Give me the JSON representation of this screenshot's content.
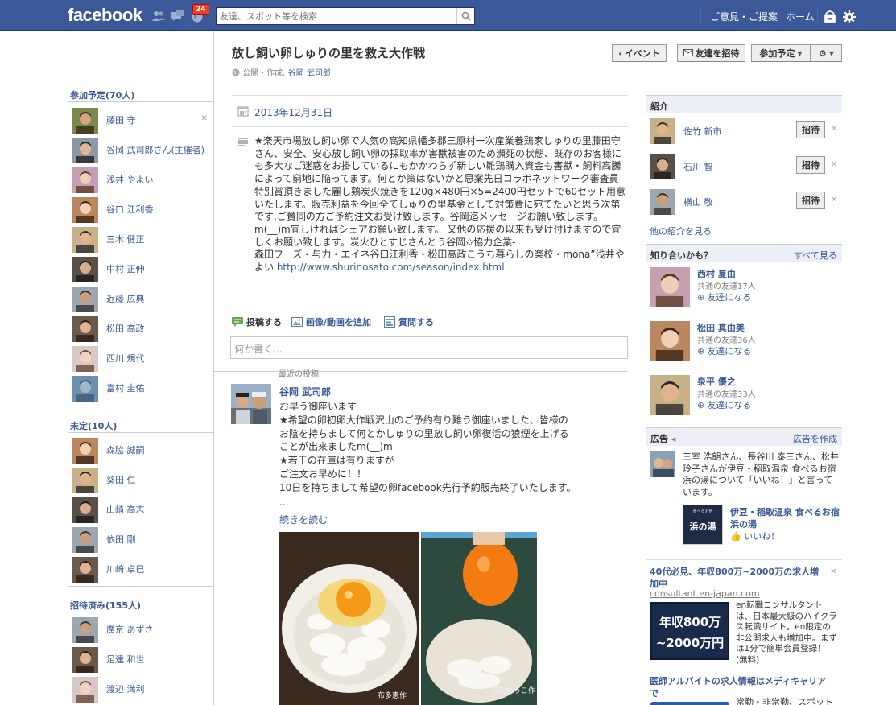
{
  "topbar": {
    "logo": "facebook",
    "notification_count": "24",
    "search_placeholder": "友達、スポット等を検索",
    "feedback": "ご意見・ご提案",
    "home": "ホーム"
  },
  "event": {
    "title": "放し飼い卵しゅりの里を救え大作戦",
    "privacy": "公開・作成:",
    "creator": "谷岡 武司郎",
    "date": "2013年12月31日",
    "description": "★楽天市場放し飼い卵で人気の高知県幡多郡三原村一次産業養鶏家しゅりの里藤田守さん、安全、安心放し飼い卵の採取率が害獣被害のため瀕死の状態、既存のお客様にも多大なご迷惑をお掛しているにもかかわらず新しい雛鶏購入資金も害獣・飼料高騰によって窮地に陥ってます。何とか策はないかと思案先日コラボネットワーク審査員特別賞頂きました麗し鶏炭火焼きを120g×480円×5=2400円セットで60セット用意いたします。販売利益を今回全てしゅりの里基金として対策費に宛てたいと思う次第です,ご賛同の方ご予約注文お受け致します。谷岡迄メッセージお願い致します。m(__)m宜しければシェアお願い致します。 又他の応援の以来も受け付けますので宜しくお願い致します。炭火ひとすじさんとう谷岡✩協力企業-\n森田フーズ・与力・エイネ谷口江利香・松田高政こうち暮らしの楽校・mona”浅井やよい ",
    "link": "http://www.shurinosato.com/season/index.html"
  },
  "toolbar": {
    "event_btn": "イベント",
    "invite_btn": "友達を招待",
    "going_btn": "参加予定"
  },
  "composer": {
    "post": "投稿する",
    "photo": "画像/動画を追加",
    "question": "質問する",
    "placeholder": "何か書く..."
  },
  "recent": {
    "label": "最近の投稿",
    "author": "谷岡 武司郎",
    "lines": [
      "お早う御座います",
      "★希望の卵初卵大作戦沢山のご予約有り難う御座いました、皆様の",
      "お陰を持ちまして何とかしゅりの里放し飼い卵復活の狼煙を上げる",
      "ことが出来ましたm(__)m",
      "★若干の在庫は有りますが",
      "ご注文お早めに！！",
      "10日を持ちまして希望の卵facebook先行予約販売終了いたします。"
    ],
    "ellipsis": "...",
    "read_more": "続きを読む",
    "photo_caption_left": "布多恵作",
    "photo_caption_right": "高知ゆうこ作"
  },
  "left": {
    "going_header": "参加予定(70人)",
    "going": [
      "藤田 守",
      "谷岡 武司郎さん(主催者)",
      "浅井 やよい",
      "谷口 江利香",
      "三木 健正",
      "中村 正伸",
      "近藤 広典",
      "松田 高政",
      "西川 規代",
      "富村 圭佑"
    ],
    "maybe_header": "未定(10人)",
    "maybe": [
      "森脇 誠嗣",
      "葵田 仁",
      "山崎 高志",
      "依田 剛",
      "川崎 卓巳"
    ],
    "invited_header": "招待済み(155人)",
    "invited": [
      "廣京 あずさ",
      "足達 和世",
      "渡辺 満利"
    ]
  },
  "right": {
    "intro_header": "紹介",
    "suggestions": [
      {
        "name": "佐竹 新市",
        "btn": "招待"
      },
      {
        "name": "石川 智",
        "btn": "招待"
      },
      {
        "name": "横山 敬",
        "btn": "招待"
      }
    ],
    "more_intro": "他の紹介を見る",
    "pymk_header": "知り合いかも？",
    "see_all": "すべて見る",
    "pymk": [
      {
        "name": "西村 夏由",
        "mutual": "共通の友達17人",
        "add": "友達になる"
      },
      {
        "name": "松田 真由美",
        "mutual": "共通の友達36人",
        "add": "友達になる"
      },
      {
        "name": "泉平 優之",
        "mutual": "共通の友達33人",
        "add": "友達になる"
      }
    ],
    "ads_header": "広告",
    "create_ad": "広告を作成",
    "ad_social": "三室 浩朗さん、長谷川 泰三さん、松井玲子さんが伊豆・稲取温泉 食べるお宿 浜の湯について「いいね！」と言っています。",
    "ad1_title": "伊豆・稲取温泉 食べるお宿 浜の湯",
    "ad1_like": "いいね！",
    "ad1_logo": "浜の湯",
    "ad1_logo_small": "食べるお宿",
    "ad2_title": "40代必見、年収800万~2000万の求人増加中",
    "ad2_domain": "consultant.en-japan.com",
    "ad2_text": "en転職コンサルタントは、日本最大級のハイクラス転職サイト。en限定の非公開求人も増加中。まずは1分で簡単会員登録！ (無料)",
    "ad2_img_line1": "年収800万",
    "ad2_img_line2": "~2000万円",
    "ad3_title": "医師アルバイトの求人情報はメディキャリアで",
    "ad3_text": "常勤・非常勤、スポット"
  }
}
